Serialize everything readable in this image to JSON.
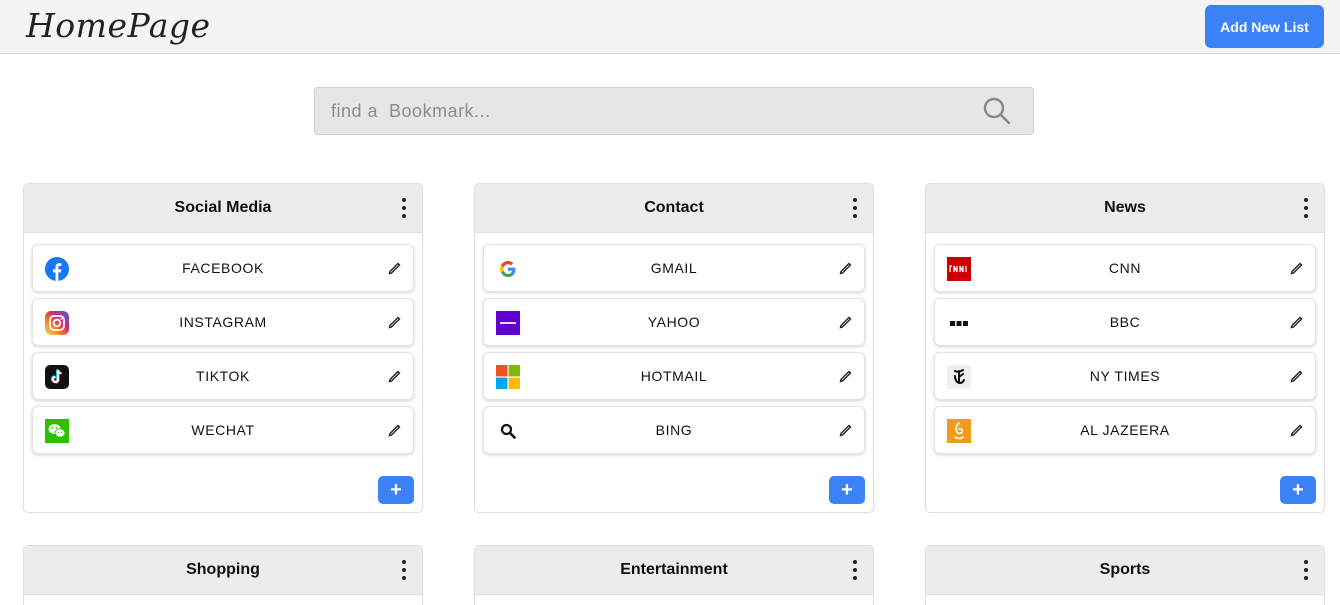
{
  "header": {
    "logo": "HomePage",
    "add_list_label": "Add New List"
  },
  "search": {
    "placeholder": "find a  Bookmark..."
  },
  "lists": [
    {
      "title": "Social Media",
      "items": [
        {
          "label": "FACEBOOK",
          "icon": "facebook-icon"
        },
        {
          "label": "INSTAGRAM",
          "icon": "instagram-icon"
        },
        {
          "label": "TIKTOK",
          "icon": "tiktok-icon"
        },
        {
          "label": "WECHAT",
          "icon": "wechat-icon"
        }
      ],
      "add_label": "+"
    },
    {
      "title": "Contact",
      "items": [
        {
          "label": "GMAIL",
          "icon": "google-icon"
        },
        {
          "label": "YAHOO",
          "icon": "yahoo-icon"
        },
        {
          "label": "HOTMAIL",
          "icon": "microsoft-icon"
        },
        {
          "label": "BING",
          "icon": "magnifier-icon"
        }
      ],
      "add_label": "+"
    },
    {
      "title": "News",
      "items": [
        {
          "label": "CNN",
          "icon": "cnn-icon"
        },
        {
          "label": "BBC",
          "icon": "bbc-icon"
        },
        {
          "label": "NY TIMES",
          "icon": "nytimes-icon"
        },
        {
          "label": "AL JAZEERA",
          "icon": "aljazeera-icon"
        }
      ],
      "add_label": "+"
    },
    {
      "title": "Shopping"
    },
    {
      "title": "Entertainment"
    },
    {
      "title": "Sports"
    }
  ],
  "colors": {
    "accent": "#3b82f6",
    "header_bg": "#f4f4f4",
    "card_header_bg": "#ececec",
    "search_bg": "#e6e6e6"
  }
}
